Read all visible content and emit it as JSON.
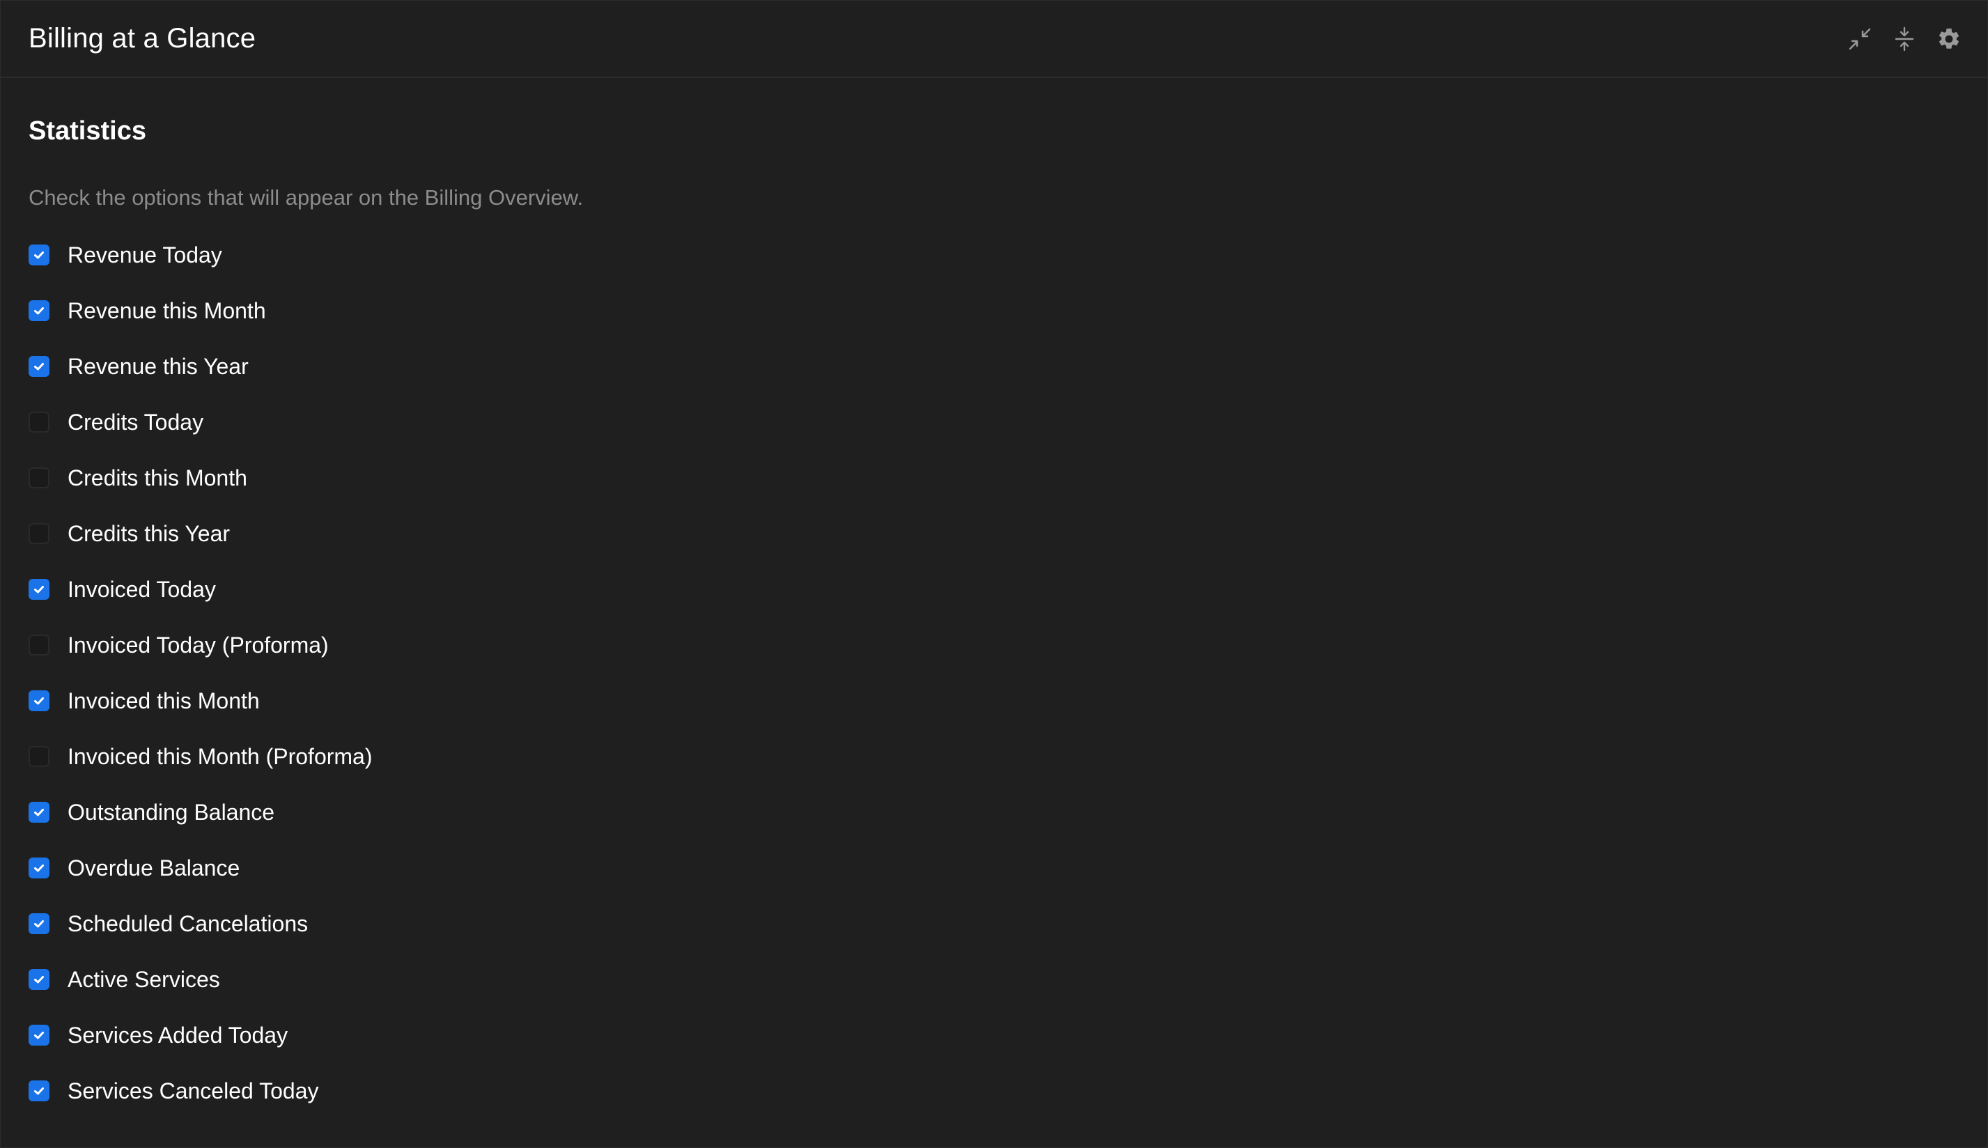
{
  "window": {
    "title": "Billing at a Glance",
    "actions": [
      {
        "name": "minimize-icon",
        "label": "Minimize"
      },
      {
        "name": "collapse-icon",
        "label": "Collapse"
      },
      {
        "name": "gear-icon",
        "label": "Settings"
      }
    ]
  },
  "section": {
    "title": "Statistics",
    "description": "Check the options that will appear on the Billing Overview."
  },
  "options": [
    {
      "label": "Revenue Today",
      "checked": true
    },
    {
      "label": "Revenue this Month",
      "checked": true
    },
    {
      "label": "Revenue this Year",
      "checked": true
    },
    {
      "label": "Credits Today",
      "checked": false
    },
    {
      "label": "Credits this Month",
      "checked": false
    },
    {
      "label": "Credits this Year",
      "checked": false
    },
    {
      "label": "Invoiced Today",
      "checked": true
    },
    {
      "label": "Invoiced Today (Proforma)",
      "checked": false
    },
    {
      "label": "Invoiced this Month",
      "checked": true
    },
    {
      "label": "Invoiced this Month (Proforma)",
      "checked": false
    },
    {
      "label": "Outstanding Balance",
      "checked": true
    },
    {
      "label": "Overdue Balance",
      "checked": true
    },
    {
      "label": "Scheduled Cancelations",
      "checked": true
    },
    {
      "label": "Active Services",
      "checked": true
    },
    {
      "label": "Services Added Today",
      "checked": true
    },
    {
      "label": "Services Canceled Today",
      "checked": true
    }
  ],
  "colors": {
    "background": "#1f1f1f",
    "accent": "#1a73e8",
    "text": "#ffffff",
    "muted": "#8c8c8c",
    "icon": "#9a9a9a"
  }
}
